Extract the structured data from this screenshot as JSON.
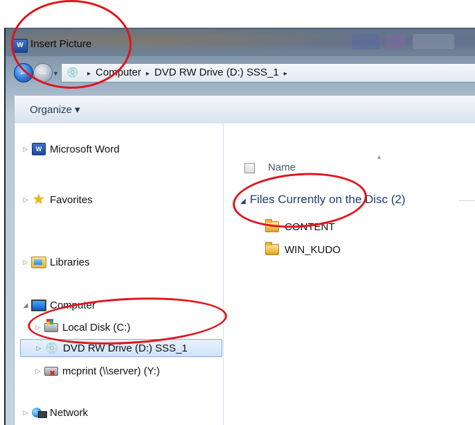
{
  "window": {
    "title": "Insert Picture",
    "app_badge": "W"
  },
  "address_bar": {
    "crumbs": [
      "Computer",
      "DVD RW Drive (D:) SSS_1"
    ],
    "separator": "▸"
  },
  "toolbar": {
    "organize_label": "Organize ▾"
  },
  "nav_pane": {
    "items": [
      {
        "label": "Microsoft Word",
        "icon": "word-icon"
      },
      {
        "label": "Favorites",
        "icon": "star-icon"
      },
      {
        "label": "Libraries",
        "icon": "libraries-icon"
      },
      {
        "label": "Computer",
        "icon": "computer-icon"
      },
      {
        "label": "Local Disk (C:)",
        "icon": "hard-disk-icon"
      },
      {
        "label": "DVD RW Drive (D:) SSS_1",
        "icon": "dvd-drive-icon",
        "selected": true
      },
      {
        "label": "mcprint (\\\\server) (Y:)",
        "icon": "disconnected-network-drive-icon"
      },
      {
        "label": "Network",
        "icon": "network-icon"
      }
    ]
  },
  "file_pane": {
    "column_name": "Name",
    "group_header": "Files Currently on the Disc (2)",
    "files": [
      {
        "name": "CONTENT",
        "icon": "folder-icon"
      },
      {
        "name": "WIN_KUDO",
        "icon": "folder-icon"
      }
    ]
  },
  "annotations": {
    "color": "#e0141b"
  }
}
